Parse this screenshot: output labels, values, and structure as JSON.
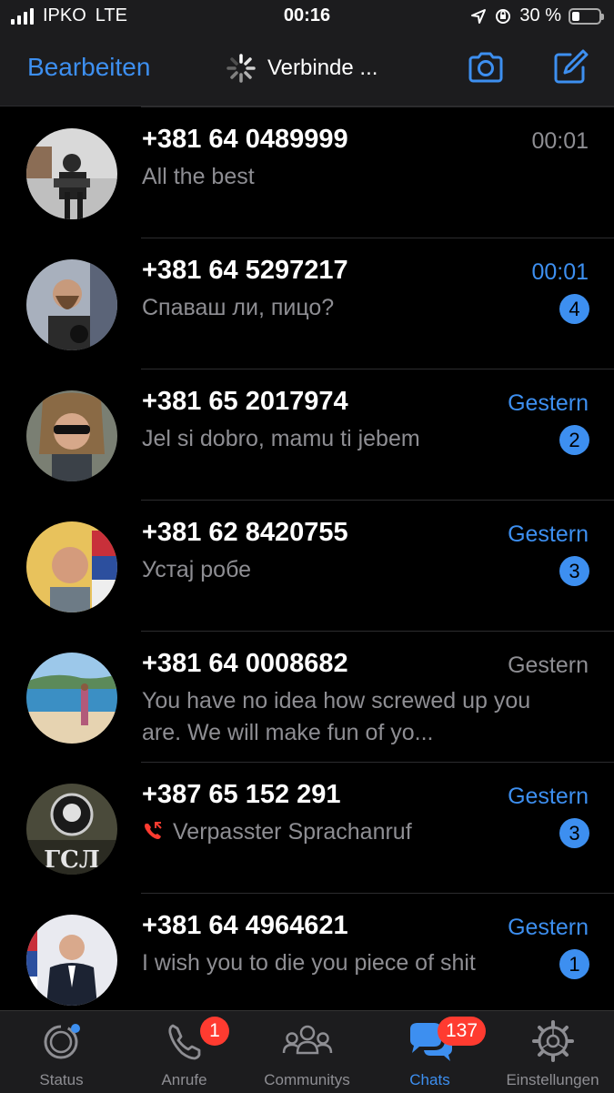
{
  "status_bar": {
    "carrier": "IPKO",
    "network": "LTE",
    "time": "00:16",
    "battery": "30 %",
    "battery_level": 0.3
  },
  "nav": {
    "edit_label": "Bearbeiten",
    "title": "Verbinde ...",
    "camera_icon": "camera-icon",
    "compose_icon": "compose-icon"
  },
  "chats": [
    {
      "name": "+381 64 0489999",
      "time": "00:01",
      "preview": "All the best",
      "unread": false,
      "badge": ""
    },
    {
      "name": "+381 64 5297217",
      "time": "00:01",
      "preview": "Спаваш ли, пицо?",
      "unread": true,
      "badge": "4"
    },
    {
      "name": "+381 65 2017974",
      "time": "Gestern",
      "preview": "Jel si dobro, mamu ti jebem",
      "unread": true,
      "badge": "2"
    },
    {
      "name": "+381 62 8420755",
      "time": "Gestern",
      "preview": "Устај робе",
      "unread": true,
      "badge": "3"
    },
    {
      "name": "+381 64 0008682",
      "time": "Gestern",
      "preview": "You have no idea how screwed up you are.  We will make fun of yo...",
      "unread": false,
      "badge": ""
    },
    {
      "name": "+387 65 152 291",
      "time": "Gestern",
      "preview": "Verpasster Sprachanruf",
      "unread": true,
      "badge": "3",
      "missed_call": true
    },
    {
      "name": "+381 64 4964621",
      "time": "Gestern",
      "preview": "I wish you to die you piece of shit",
      "unread": true,
      "badge": "1"
    }
  ],
  "tabs": [
    {
      "label": "Status",
      "icon": "status-icon",
      "badge": ""
    },
    {
      "label": "Anrufe",
      "icon": "phone-icon",
      "badge": "1"
    },
    {
      "label": "Communitys",
      "icon": "communities-icon",
      "badge": ""
    },
    {
      "label": "Chats",
      "icon": "chats-icon",
      "badge": "137",
      "active": true
    },
    {
      "label": "Einstellungen",
      "icon": "gear-icon",
      "badge": ""
    }
  ],
  "colors": {
    "accent": "#3d8ff0",
    "badge_red": "#ff3b30",
    "missed_call": "#ff3b30"
  }
}
